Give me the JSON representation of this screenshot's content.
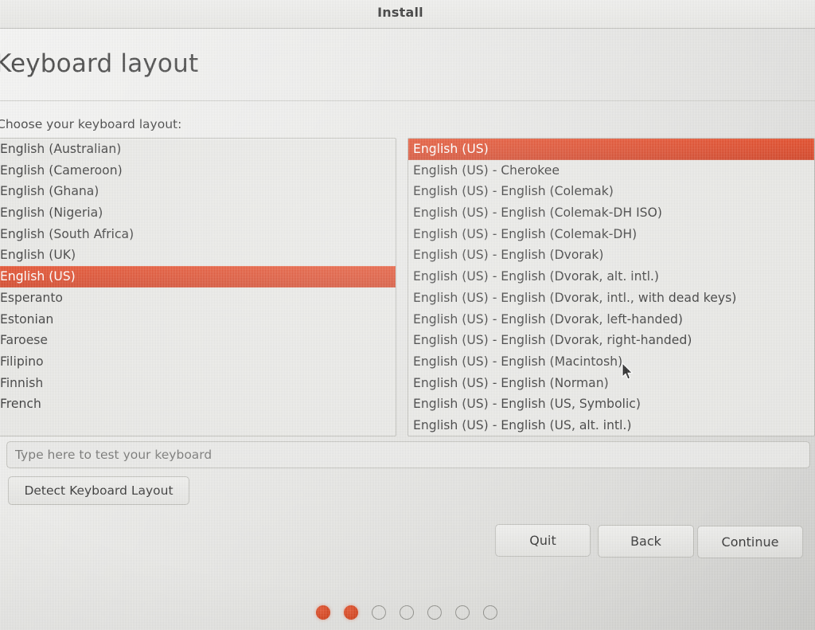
{
  "window": {
    "title": "Install"
  },
  "page": {
    "title": "Keyboard layout",
    "instruction": "Choose your keyboard layout:"
  },
  "layout_list": {
    "name": "keyboard-layout-list",
    "selected": "English (US)",
    "items": [
      {
        "label": "English (Australian)",
        "selected": false
      },
      {
        "label": "English (Cameroon)",
        "selected": false
      },
      {
        "label": "English (Ghana)",
        "selected": false
      },
      {
        "label": "English (Nigeria)",
        "selected": false
      },
      {
        "label": "English (South Africa)",
        "selected": false
      },
      {
        "label": "English (UK)",
        "selected": false
      },
      {
        "label": "English (US)",
        "selected": true
      },
      {
        "label": "Esperanto",
        "selected": false
      },
      {
        "label": "Estonian",
        "selected": false
      },
      {
        "label": "Faroese",
        "selected": false
      },
      {
        "label": "Filipino",
        "selected": false
      },
      {
        "label": "Finnish",
        "selected": false
      },
      {
        "label": "French",
        "selected": false
      }
    ]
  },
  "variant_list": {
    "name": "keyboard-variant-list",
    "selected": "English (US)",
    "items": [
      {
        "label": "English (US)",
        "selected": true
      },
      {
        "label": "English (US) - Cherokee",
        "selected": false
      },
      {
        "label": "English (US) - English (Colemak)",
        "selected": false
      },
      {
        "label": "English (US) - English (Colemak-DH ISO)",
        "selected": false
      },
      {
        "label": "English (US) - English (Colemak-DH)",
        "selected": false
      },
      {
        "label": "English (US) - English (Dvorak)",
        "selected": false
      },
      {
        "label": "English (US) - English (Dvorak, alt. intl.)",
        "selected": false
      },
      {
        "label": "English (US) - English (Dvorak, intl., with dead keys)",
        "selected": false
      },
      {
        "label": "English (US) - English (Dvorak, left-handed)",
        "selected": false
      },
      {
        "label": "English (US) - English (Dvorak, right-handed)",
        "selected": false
      },
      {
        "label": "English (US) - English (Macintosh)",
        "selected": false
      },
      {
        "label": "English (US) - English (Norman)",
        "selected": false
      },
      {
        "label": "English (US) - English (US, Symbolic)",
        "selected": false
      },
      {
        "label": "English (US) - English (US, alt. intl.)",
        "selected": false
      }
    ]
  },
  "keyboard_test": {
    "placeholder": "Type here to test your keyboard",
    "value": ""
  },
  "detect_button": {
    "label": "Detect Keyboard Layout"
  },
  "navigation": {
    "quit_label": "Quit",
    "back_label": "Back",
    "continue_label": "Continue"
  },
  "progress": {
    "total_steps": 7,
    "current_step": 2,
    "states": [
      "filled",
      "filled",
      "empty",
      "empty",
      "empty",
      "empty",
      "empty"
    ]
  },
  "colors": {
    "accent": "#d93f1e",
    "selection_text": "#ffffff",
    "background": "#e8e8e6",
    "border": "#b9b9b4",
    "text": "#2e2e2e",
    "placeholder_text": "#6e6e6c",
    "dot_empty_border": "#8d8d88"
  }
}
